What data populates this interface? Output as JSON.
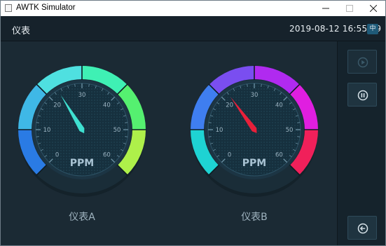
{
  "window": {
    "title": "AWTK Simulator",
    "minimize_icon": "minimize-icon",
    "maximize_icon": "maximize-icon",
    "close_icon": "close-icon"
  },
  "header": {
    "title": "仪表",
    "datetime": "2019-08-12 16:55:59",
    "lang_button": "中"
  },
  "gauges": [
    {
      "name": "仪表A",
      "unit": "PPM",
      "min": 0,
      "max": 60,
      "ticks": [
        "0",
        "10",
        "20",
        "30",
        "40",
        "50",
        "60"
      ],
      "value": 23,
      "needle_color": "#3fe0d0",
      "arc_colors": [
        "#2a7be4",
        "#3fb8e6",
        "#4fe0e0",
        "#3ff0b4",
        "#55f070",
        "#aef04a"
      ]
    },
    {
      "name": "仪表B",
      "unit": "PPM",
      "min": 0,
      "max": 60,
      "ticks": [
        "0",
        "10",
        "20",
        "30",
        "40",
        "50",
        "60"
      ],
      "value": 22,
      "needle_color": "#e8203a",
      "arc_colors": [
        "#1ed3d3",
        "#3f7ef0",
        "#7a4ef0",
        "#b02af0",
        "#e01ee0",
        "#f0205a"
      ]
    }
  ],
  "sidebar": {
    "play_icon": "play-icon",
    "pause_icon": "pause-icon",
    "back_icon": "back-icon"
  }
}
